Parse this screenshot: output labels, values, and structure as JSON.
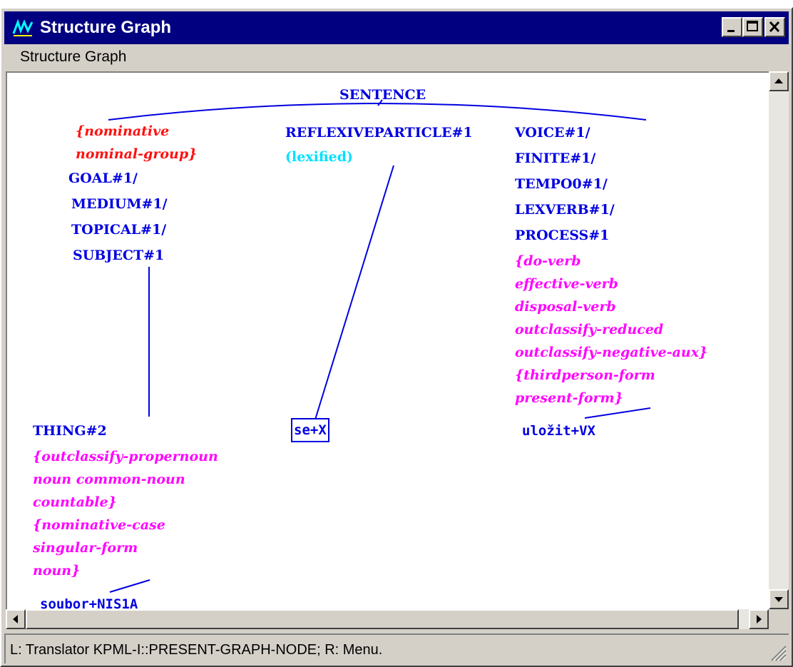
{
  "window": {
    "title": "Structure Graph",
    "menu": [
      "Structure Graph"
    ],
    "status": "L: Translator KPML-I::PRESENT-GRAPH-NODE; R: Menu."
  },
  "colors": {
    "titlebar": "#000080",
    "node_label": "#0000e0",
    "feature_red": "#ff1010",
    "feature_magenta": "#ff00ff",
    "lexified": "#00e0ff"
  },
  "icons": [
    "app-icon",
    "minimize-icon",
    "maximize-icon",
    "close-icon",
    "scroll-up-icon",
    "scroll-down-icon",
    "scroll-left-icon",
    "scroll-right-icon",
    "resize-grip-icon"
  ],
  "graph": {
    "root": "SENTENCE",
    "left_features": [
      "{nominative",
      " nominal-group}"
    ],
    "left_functions": [
      "GOAL#1/",
      "MEDIUM#1/",
      "TOPICAL#1/",
      "SUBJECT#1"
    ],
    "middle_function": "REFLEXIVEPARTICLE#1",
    "middle_note": "(lexified)",
    "right_functions": [
      "VOICE#1/",
      "FINITE#1/",
      "TEMPO0#1/",
      "LEXVERB#1/",
      "PROCESS#1"
    ],
    "right_features": [
      "{do-verb",
      " effective-verb",
      " disposal-verb",
      " outclassify-reduced",
      " outclassify-negative-aux}",
      "{thirdperson-form",
      " present-form}"
    ],
    "thing_label": "THING#2",
    "thing_features": [
      "{outclassify-propernoun",
      " noun common-noun",
      " countable}",
      "{nominative-case",
      " singular-form",
      " noun}"
    ],
    "leaves": {
      "left": "soubor+NIS1A",
      "middle": "se+X",
      "right": "uložit+VX"
    }
  }
}
